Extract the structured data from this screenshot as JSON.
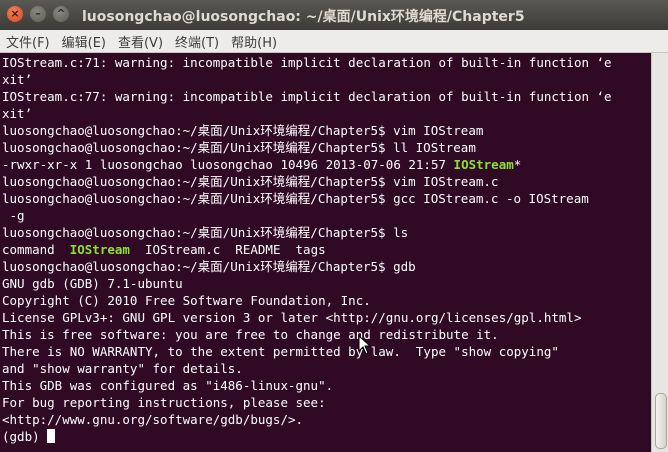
{
  "window": {
    "title": "luosongchao@luosongchao: ~/桌面/Unix环境编程/Chapter5",
    "buttons": {
      "close": "×",
      "minimize": "–",
      "maximize": "^"
    }
  },
  "menubar": {
    "items": [
      "文件(F)",
      "编辑(E)",
      "查看(V)",
      "终端(T)",
      "帮助(H)"
    ]
  },
  "terminal": {
    "lines": [
      {
        "text": "IOStream.c:71: warning: incompatible implicit declaration of built-in function ‘e"
      },
      {
        "text": "xit’"
      },
      {
        "text": "IOStream.c:77: warning: incompatible implicit declaration of built-in function ‘e"
      },
      {
        "text": "xit’"
      },
      {
        "text": "luosongchao@luosongchao:~/桌面/Unix环境编程/Chapter5$ vim IOStream"
      },
      {
        "text": "luosongchao@luosongchao:~/桌面/Unix环境编程/Chapter5$ ll IOStream"
      },
      {
        "pre": "-rwxr-xr-x 1 luosongchao luosongchao 10496 2013-07-06 21:57 ",
        "hl": "IOStream",
        "post": "*"
      },
      {
        "text": "luosongchao@luosongchao:~/桌面/Unix环境编程/Chapter5$ vim IOStream.c"
      },
      {
        "text": "luosongchao@luosongchao:~/桌面/Unix环境编程/Chapter5$ gcc IOStream.c -o IOStream"
      },
      {
        "text": " -g"
      },
      {
        "text": "luosongchao@luosongchao:~/桌面/Unix环境编程/Chapter5$ ls"
      },
      {
        "pre": "command  ",
        "hl": "IOStream",
        "post": "  IOStream.c  README  tags"
      },
      {
        "text": "luosongchao@luosongchao:~/桌面/Unix环境编程/Chapter5$ gdb"
      },
      {
        "text": "GNU gdb (GDB) 7.1-ubuntu"
      },
      {
        "text": "Copyright (C) 2010 Free Software Foundation, Inc."
      },
      {
        "text": "License GPLv3+: GNU GPL version 3 or later <http://gnu.org/licenses/gpl.html>"
      },
      {
        "text": "This is free software: you are free to change and redistribute it."
      },
      {
        "text": "There is NO WARRANTY, to the extent permitted by law.  Type \"show copying\""
      },
      {
        "text": "and \"show warranty\" for details."
      },
      {
        "text": "This GDB was configured as \"i486-linux-gnu\"."
      },
      {
        "text": "For bug reporting instructions, please see:"
      },
      {
        "text": "<http://www.gnu.org/software/gdb/bugs/>."
      }
    ],
    "prompt": "(gdb) ",
    "colors": {
      "background": "#300a24",
      "text": "#ffffff",
      "executable": "#8ae234"
    }
  },
  "icons": {
    "cursor": "mouse-pointer-icon",
    "caret": "text-cursor-block"
  }
}
